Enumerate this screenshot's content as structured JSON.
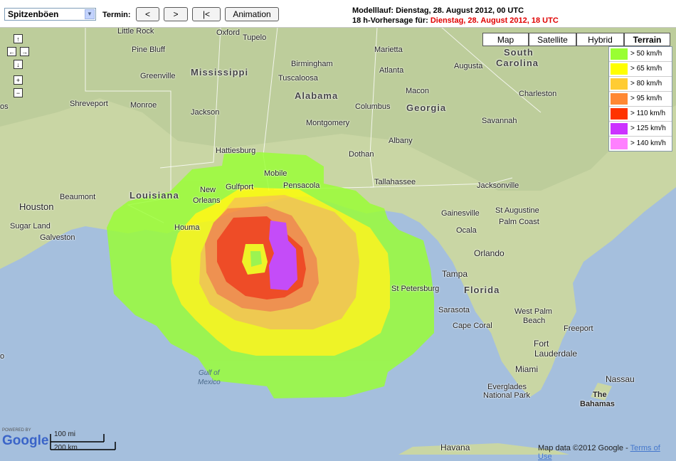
{
  "toolbar": {
    "parameter_select": "Spitzenböen",
    "termin_label": "Termin:",
    "prev_button": "<",
    "next_button": ">",
    "first_button": "|<",
    "animation_button": "Animation",
    "modelllauf": "Modelllauf: Dienstag, 28. August 2012, 00 UTC",
    "vorhersage_prefix": "18 h-Vorhersage für:",
    "vorhersage_value": "Dienstag, 28. August 2012, 18 UTC"
  },
  "map_types": [
    "Map",
    "Satellite",
    "Hybrid",
    "Terrain"
  ],
  "active_map_type": "Terrain",
  "legend": [
    {
      "label": "> 50 km/h",
      "color": "#99ff33"
    },
    {
      "label": "> 65 km/h",
      "color": "#ffff00"
    },
    {
      "label": "> 80 km/h",
      "color": "#ffcc33"
    },
    {
      "label": "> 95 km/h",
      "color": "#ff8833"
    },
    {
      "label": "> 110 km/h",
      "color": "#ff3300"
    },
    {
      "label": "> 125 km/h",
      "color": "#cc33ff"
    },
    {
      "label": "> 140 km/h",
      "color": "#ff80ff"
    }
  ],
  "nav": {
    "up": "↑",
    "left": "←",
    "right": "→",
    "down": "↓",
    "zoom_in": "+",
    "zoom_out": "−"
  },
  "places": {
    "little_rock": "Little Rock",
    "oxford": "Oxford",
    "tupelo": "Tupelo",
    "pine_bluff": "Pine Bluff",
    "marietta": "Marietta",
    "mississippi": "Mississippi",
    "birmingham": "Birmingham",
    "atlanta": "Atlanta",
    "augusta": "Augusta",
    "greenville": "Greenville",
    "tuscaloosa": "Tuscaloosa",
    "south_carolina_1": "South",
    "south_carolina_2": "Carolina",
    "alabama": "Alabama",
    "macon": "Macon",
    "charleston": "Charleston",
    "shreveport": "Shreveport",
    "monroe": "Monroe",
    "columbus": "Columbus",
    "georgia": "Georgia",
    "jackson": "Jackson",
    "montgomery": "Montgomery",
    "savannah": "Savannah",
    "albany": "Albany",
    "hattiesburg": "Hattiesburg",
    "dothan": "Dothan",
    "mobile": "Mobile",
    "tallahassee": "Tallahassee",
    "jacksonville": "Jacksonville",
    "beaumont": "Beaumont",
    "louisiana": "Louisiana",
    "new_orleans_1": "New",
    "new_orleans_2": "Orleans",
    "gulfport": "Gulfport",
    "pensacola": "Pensacola",
    "gainesville": "Gainesville",
    "st_augustine": "St Augustine",
    "houston": "Houston",
    "palm_coast": "Palm Coast",
    "sugar_land": "Sugar Land",
    "houma": "Houma",
    "ocala": "Ocala",
    "galveston": "Galveston",
    "orlando": "Orlando",
    "tampa": "Tampa",
    "st_petersburg": "St Petersburg",
    "florida": "Florida",
    "sarasota": "Sarasota",
    "west_palm": "West Palm",
    "beach": "Beach",
    "cape_coral": "Cape Coral",
    "freeport": "Freeport",
    "fort_lauderdale_1": "Fort",
    "fort_lauderdale_2": "Lauderdale",
    "miami": "Miami",
    "gulf_1": "Gulf of",
    "gulf_2": "Mexico",
    "nassau": "Nassau",
    "everglades_1": "Everglades",
    "everglades_2": "National Park",
    "bahamas_1": "The",
    "bahamas_2": "Bahamas",
    "havana": "Havana",
    "edge_os": "os",
    "edge_o": "o"
  },
  "footer": {
    "powered_by": "POWERED BY",
    "google": "Google",
    "scale_mi": "100 mi",
    "scale_km": "200 km",
    "map_data": "Map data ©2012 Google - ",
    "terms": "Terms of Use"
  }
}
